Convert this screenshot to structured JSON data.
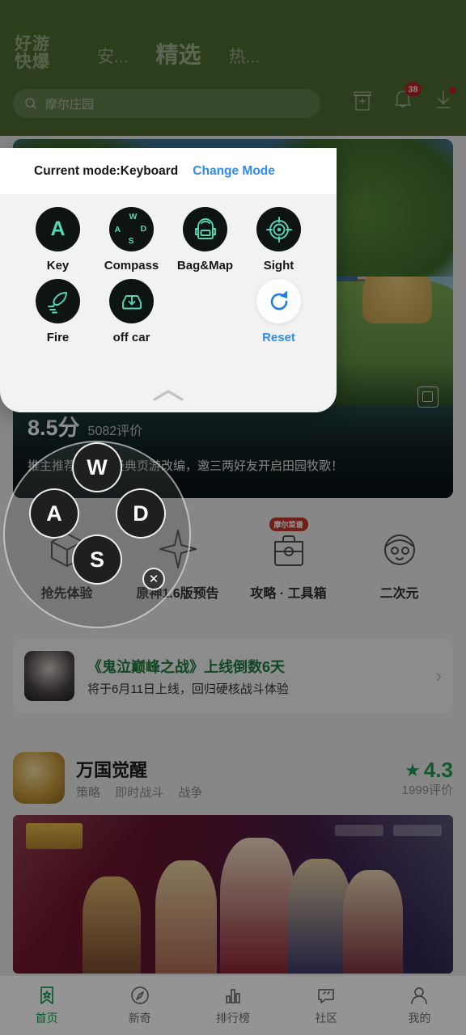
{
  "header": {
    "logo_line1": "好游",
    "logo_line2": "快爆",
    "tabs": [
      {
        "label": "安...",
        "active": false
      },
      {
        "label": "精选",
        "active": true
      },
      {
        "label": "热...",
        "active": false
      }
    ],
    "search": {
      "value": "摩尔庄园",
      "icon": "search-icon"
    },
    "icons": [
      {
        "name": "checkin-icon",
        "badge": ""
      },
      {
        "name": "bell-icon",
        "badge": "38"
      },
      {
        "name": "download-icon",
        "badge": ""
      }
    ]
  },
  "hero": {
    "score": "8.5分",
    "rating_count": "5082评价",
    "description": "推主推荐，同名经典页游改编，邀三两好友开启田园牧歌！",
    "expand_icon": "expand-icon"
  },
  "categories": [
    {
      "label": "抢先体验",
      "icon": "box-icon",
      "badge": ""
    },
    {
      "label": "原神1.6版预告",
      "icon": "genshin-logo-icon",
      "badge": ""
    },
    {
      "label": "攻略 · 工具箱",
      "icon": "toolbox-icon",
      "badge": "摩尔菜谱"
    },
    {
      "label": "二次元",
      "icon": "anime-girl-icon",
      "badge": ""
    }
  ],
  "news": {
    "title": "《鬼泣巅峰之战》上线倒数6天",
    "subtitle": "将于6月11日上线，回归硬核战斗体验",
    "arrow_icon": "chevron-right-icon"
  },
  "game_card": {
    "name": "万国觉醒",
    "tags": [
      "策略",
      "即时战斗",
      "战争"
    ],
    "rating": "4.3",
    "rating_count": "1999评价",
    "star_icon": "star-icon"
  },
  "bottom_nav": [
    {
      "label": "首页",
      "icon": "bookmark-star-icon",
      "active": true
    },
    {
      "label": "新奇",
      "icon": "compass-icon",
      "active": false
    },
    {
      "label": "排行榜",
      "icon": "bar-chart-icon",
      "active": false
    },
    {
      "label": "社区",
      "icon": "chat-bubble-icon",
      "active": false
    },
    {
      "label": "我的",
      "icon": "person-icon",
      "active": false
    }
  ],
  "joystick": {
    "keys": [
      "W",
      "A",
      "D",
      "S"
    ],
    "close_icon": "close-icon"
  },
  "panel": {
    "mode_text": "Current mode:Keyboard",
    "change_mode": "Change Mode",
    "handle_icon": "chevron-up-icon",
    "items": [
      {
        "label": "Key",
        "icon": "letter-key-icon",
        "style": "dark",
        "glyph": "A"
      },
      {
        "label": "Compass",
        "icon": "wasd-compass-icon",
        "style": "dark",
        "glyph": "WASD"
      },
      {
        "label": "Bag&Map",
        "icon": "backpack-icon",
        "style": "dark",
        "glyph": ""
      },
      {
        "label": "Sight",
        "icon": "crosshair-icon",
        "style": "dark",
        "glyph": ""
      },
      {
        "label": "Fire",
        "icon": "rocket-fire-icon",
        "style": "dark",
        "glyph": ""
      },
      {
        "label": "off car",
        "icon": "exit-car-icon",
        "style": "dark",
        "glyph": ""
      },
      {
        "label": "",
        "icon": "",
        "style": "empty",
        "glyph": ""
      },
      {
        "label": "Reset",
        "icon": "refresh-icon",
        "style": "white",
        "glyph": ""
      }
    ]
  },
  "colors": {
    "header_green": "#4c6b30",
    "accent_blue": "#2d8cf0",
    "accent_teal": "#56d6b5",
    "brand_green": "#1e9a53"
  }
}
